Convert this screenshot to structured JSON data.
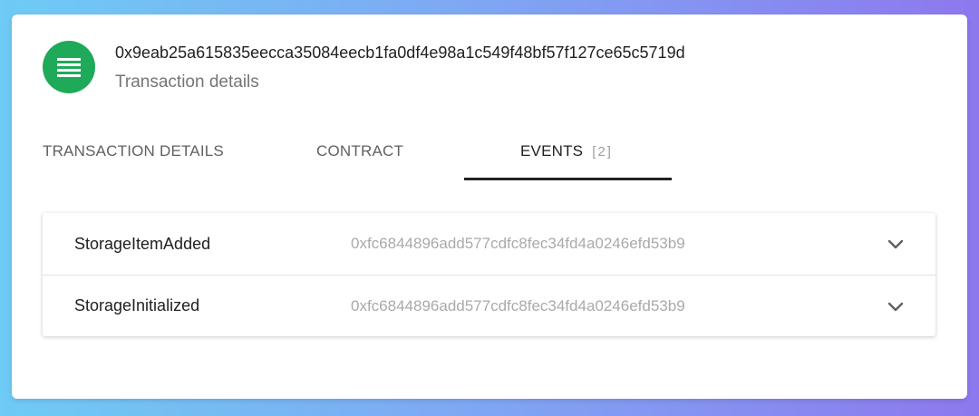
{
  "transaction": {
    "hash": "0x9eab25a615835eecca35084eecb1fa0df4e98a1c549f48bf57f127ce65c5719d",
    "subtitle": "Transaction details",
    "avatar_icon": "list-icon",
    "avatar_color": "#1faa5a"
  },
  "tabs": [
    {
      "label": "TRANSACTION DETAILS",
      "count": "",
      "active": false
    },
    {
      "label": "CONTRACT",
      "count": "",
      "active": false
    },
    {
      "label": "EVENTS",
      "count": "[2]",
      "active": true
    }
  ],
  "events": [
    {
      "name": "StorageItemAdded",
      "address": "0xfc6844896add577cdfc8fec34fd4a0246efd53b9",
      "icon": "chevron-down-icon"
    },
    {
      "name": "StorageInitialized",
      "address": "0xfc6844896add577cdfc8fec34fd4a0246efd53b9",
      "icon": "chevron-down-icon"
    }
  ]
}
